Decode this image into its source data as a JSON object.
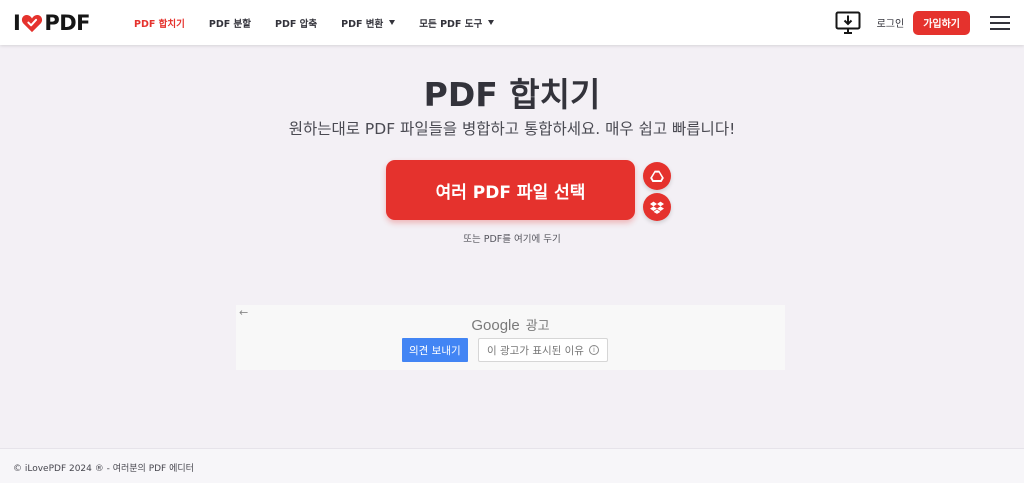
{
  "logo": {
    "prefix": "I",
    "suffix": "PDF"
  },
  "nav": {
    "items": [
      {
        "label": "PDF 합치기",
        "active": true,
        "dropdown": false
      },
      {
        "label": "PDF 분할",
        "active": false,
        "dropdown": false
      },
      {
        "label": "PDF 압축",
        "active": false,
        "dropdown": false
      },
      {
        "label": "PDF 변환",
        "active": false,
        "dropdown": true
      },
      {
        "label": "모든 PDF 도구",
        "active": false,
        "dropdown": true
      }
    ]
  },
  "header": {
    "desktop_icon": "desktop-download-icon",
    "login_label": "로그인",
    "signup_label": "가입하기",
    "menu_icon": "hamburger-menu-icon"
  },
  "main": {
    "title": "PDF 합치기",
    "subtitle": "원하는대로 PDF 파일들을 병합하고 통합하세요. 매우 쉽고 빠릅니다!",
    "select_button_label": "여러 PDF 파일 선택",
    "gdrive_icon": "google-drive-icon",
    "dropbox_icon": "dropbox-icon",
    "drop_hint": "또는 PDF를 여기에 두기"
  },
  "ad": {
    "back_arrow": "←",
    "google_word": "Google",
    "ad_label": "광고",
    "feedback_label": "의견 보내기",
    "why_label": "이 광고가 표시된 이유",
    "info_glyph": "i"
  },
  "footer": {
    "text": "© iLovePDF 2024 ® - 여러분의 PDF 에디터"
  },
  "colors": {
    "brand_red": "#e5322d",
    "page_bg": "#f3f0f5",
    "text_dark": "#33333b",
    "ad_blue": "#4285f4"
  }
}
